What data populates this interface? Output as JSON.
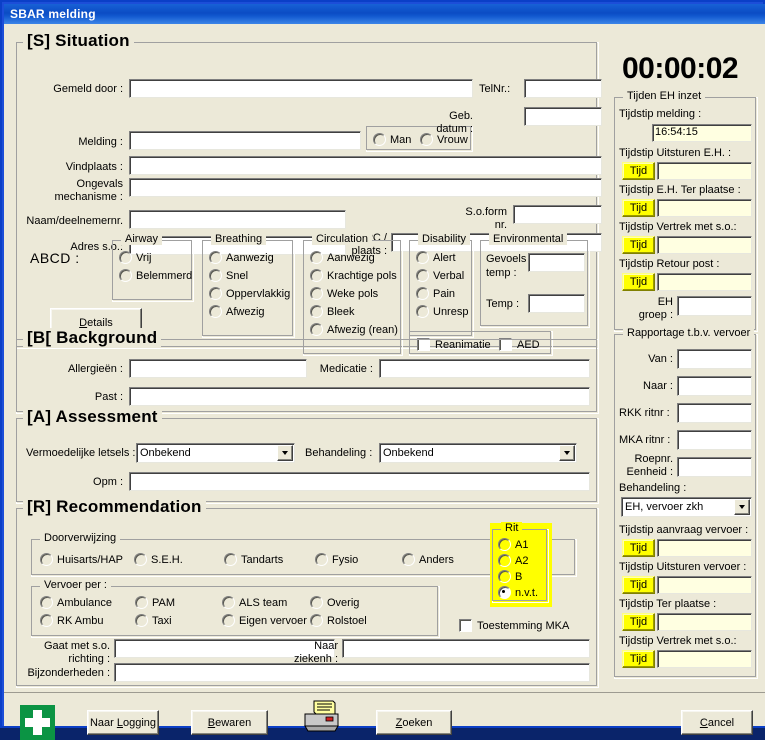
{
  "window": {
    "title": "SBAR melding"
  },
  "situation": {
    "legend": "[S] Situation",
    "labels": {
      "gemeld_door": "Gemeld door :",
      "telnr": "TelNr.:",
      "melding": "Melding :",
      "geb_datum_l1": "Geb.",
      "geb_datum_l2": "datum :",
      "vindplaats": "Vindplaats :",
      "ongevals_l1": "Ongevals",
      "ongevals_l2": "mechanisme :",
      "naam_deelnemernr": "Naam/deelnemernr.",
      "soform_l1": "S.o.form",
      "soform_l2": "nr.",
      "adres_so": "Adres s.o.:",
      "pc_l1": "PC /",
      "pc_l2": "plaats :"
    },
    "values": {
      "gemeld_door": "",
      "telnr": "",
      "melding": "",
      "geb_datum": "",
      "vindplaats": "",
      "ongevals_mechanisme": "",
      "naam_deelnemernr": "",
      "soform_nr": "",
      "adres_so": "",
      "pc_plaats": ""
    },
    "gender": {
      "man": "Man",
      "vrouw": "Vrouw",
      "selected": ""
    }
  },
  "abcd": {
    "label": "ABCD :",
    "details_button": "Details",
    "airway": {
      "legend": "Airway",
      "options": [
        "Vrij",
        "Belemmerd"
      ],
      "selected": ""
    },
    "breathing": {
      "legend": "Breathing",
      "options": [
        "Aanwezig",
        "Snel",
        "Oppervlakkig",
        "Afwezig"
      ],
      "selected": ""
    },
    "circulation": {
      "legend": "Circulation",
      "options": [
        "Aanwezig",
        "Krachtige pols",
        "Weke pols",
        "Bleek",
        "Afwezig (rean)"
      ],
      "selected": ""
    },
    "disability": {
      "legend": "Disability",
      "options": [
        "Alert",
        "Verbal",
        "Pain",
        "Unresp"
      ],
      "selected": ""
    },
    "environmental": {
      "legend": "Environmental",
      "gevoels_temp_l1": "Gevoels",
      "gevoels_temp_l2": "temp :",
      "gevoels_temp_value": "",
      "temp_label": "Temp :",
      "temp_value": ""
    },
    "reanimatie": {
      "label": "Reanimatie",
      "checked": false
    },
    "aed": {
      "label": "AED",
      "checked": false
    }
  },
  "background": {
    "legend": "[B[ Background",
    "allergieen_label": "Allergieën :",
    "allergieen_value": "",
    "medicatie_label": "Medicatie :",
    "medicatie_value": "",
    "past_label": "Past :",
    "past_value": ""
  },
  "assessment": {
    "legend": "[A] Assessment",
    "letsels_label": "Vermoedelijke letsels :",
    "letsels_value": "Onbekend",
    "behandeling_label": "Behandeling :",
    "behandeling_value": "Onbekend",
    "opm_label": "Opm :",
    "opm_value": ""
  },
  "recommendation": {
    "legend": "[R] Recommendation",
    "doorverwijzing": {
      "legend": "Doorverwijzing",
      "options": [
        "Huisarts/HAP",
        "S.E.H.",
        "Tandarts",
        "Fysio",
        "Anders"
      ],
      "selected": ""
    },
    "vervoer_per": {
      "legend": "Vervoer per :",
      "options": [
        "Ambulance",
        "PAM",
        "ALS team",
        "Overig",
        "RK Ambu",
        "Taxi",
        "Eigen vervoer",
        "Rolstoel"
      ],
      "selected": ""
    },
    "rit": {
      "legend": "Rit",
      "options": [
        "A1",
        "A2",
        "B",
        "n.v.t."
      ],
      "selected": "n.v.t.",
      "highlight_color": "#ffff00"
    },
    "toestemming_mka": {
      "label": "Toestemming MKA",
      "checked": false
    },
    "gaat_met_so_l1": "Gaat met s.o.",
    "gaat_met_so_l2": "richting :",
    "gaat_met_so_value": "",
    "naar_ziekenh_l1": "Naar",
    "naar_ziekenh_l2": "ziekenh :",
    "naar_ziekenh_value": "",
    "bijzonderheden_label": "Bijzonderheden :",
    "bijzonderheden_value": ""
  },
  "sidebar": {
    "timer": "00:00:02",
    "tijden_eh": {
      "legend": "Tijden EH inzet",
      "tijdstip_melding_label": "Tijdstip melding :",
      "tijdstip_melding_value": "16:54:15",
      "rows": [
        {
          "label": "Tijdstip Uitsturen E.H. :",
          "button": "Tijd",
          "value": ""
        },
        {
          "label": "Tijdstip E.H. Ter plaatse :",
          "button": "Tijd",
          "value": ""
        },
        {
          "label": "Tijdstip Vertrek met s.o.:",
          "button": "Tijd",
          "value": ""
        },
        {
          "label": "Tijdstip Retour post :",
          "button": "Tijd",
          "value": ""
        }
      ],
      "eh_groep_l1": "EH",
      "eh_groep_l2": "groep :",
      "eh_groep_value": ""
    },
    "rapportage": {
      "legend": "Rapportage t.b.v. vervoer",
      "van_label": "Van :",
      "van_value": "",
      "naar_label": "Naar :",
      "naar_value": "",
      "rkk_label": "RKK ritnr :",
      "rkk_value": "",
      "mka_label": "MKA ritnr :",
      "mka_value": "",
      "roepnr_l1": "Roepnr.",
      "roepnr_l2": "Eenheid :",
      "roepnr_value": "",
      "behandeling_label": "Behandeling :",
      "behandeling_value": "EH, vervoer zkh",
      "rows": [
        {
          "label": "Tijdstip aanvraag vervoer :",
          "button": "Tijd",
          "value": ""
        },
        {
          "label": "Tijdstip Uitsturen vervoer :",
          "button": "Tijd",
          "value": ""
        },
        {
          "label": "Tijdstip Ter plaatse :",
          "button": "Tijd",
          "value": ""
        },
        {
          "label": "Tijdstip Vertrek met s.o.:",
          "button": "Tijd",
          "value": ""
        }
      ]
    }
  },
  "footer": {
    "first_aid_icon": "first-aid-cross-icon",
    "naar_logging": "Naar Logging",
    "bewaren": "Bewaren",
    "print_icon": "printer-icon",
    "zoeken": "Zoeken",
    "cancel": "Cancel"
  }
}
